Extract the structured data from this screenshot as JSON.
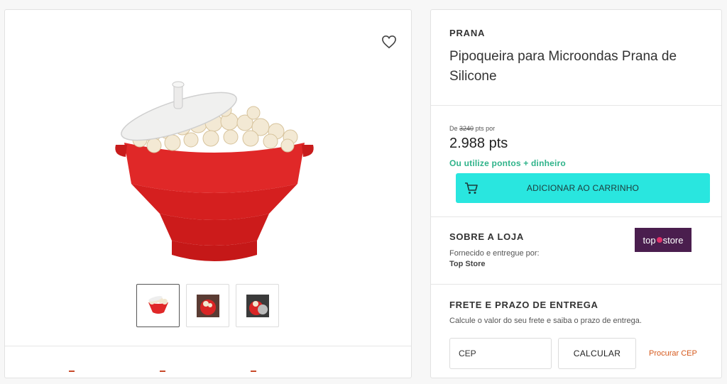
{
  "product": {
    "brand": "PRANA",
    "title": "Pipoqueira para Microondas Prana de Silicone",
    "favorite_icon": "heart-outline-icon",
    "image_desc_icon": "popcorn-bowl",
    "thumbnails": [
      "thumb-1",
      "thumb-2",
      "thumb-3"
    ]
  },
  "price": {
    "from_prefix": "De",
    "old_value": "3240",
    "from_suffix": "pts por",
    "current": "2.988 pts",
    "alt_payment": "Ou utilize pontos + dinheiro",
    "add_to_cart": "ADICIONAR AO CARRINHO",
    "button_color": "#29e6df",
    "alt_color": "#2fb38a"
  },
  "store": {
    "heading": "SOBRE A LOJA",
    "supplied_by": "Fornecido e entregue por:",
    "name": "Top Store",
    "logo_left": "top",
    "logo_right": "store"
  },
  "shipping": {
    "heading": "FRETE E PRAZO DE ENTREGA",
    "subtitle": "Calcule o valor do seu frete e saiba o prazo de entrega.",
    "cep_placeholder": "CEP",
    "calculate": "CALCULAR",
    "find_cep": "Procurar CEP",
    "link_color": "#d6591c"
  }
}
